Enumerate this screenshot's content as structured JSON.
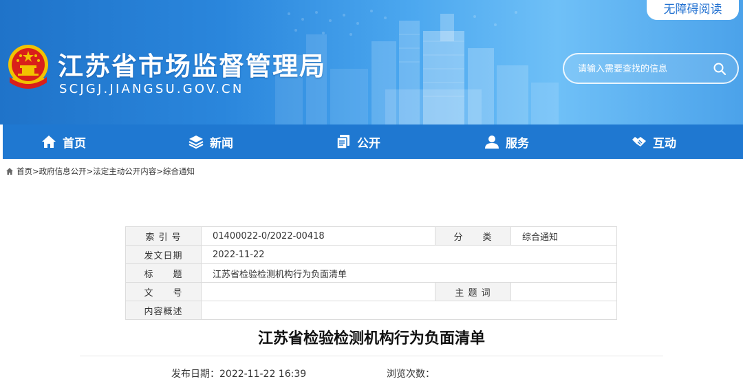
{
  "header": {
    "site_title": "江苏省市场监督管理局",
    "site_domain": "SCJGJ.JIANGSU.GOV.CN",
    "accessibility_label": "无障碍阅读",
    "search": {
      "placeholder": "请输入需要查找的信息",
      "value": ""
    }
  },
  "nav": {
    "items": [
      {
        "label": "首页",
        "icon": "home-icon"
      },
      {
        "label": "新闻",
        "icon": "layers-icon"
      },
      {
        "label": "公开",
        "icon": "documents-icon"
      },
      {
        "label": "服务",
        "icon": "user-icon"
      },
      {
        "label": "互动",
        "icon": "handshake-icon"
      }
    ]
  },
  "breadcrumb": {
    "items": [
      "首页",
      "政府信息公开",
      "法定主动公开内容",
      "综合通知"
    ],
    "separator": ">"
  },
  "info_table": {
    "index_label": "索 引 号",
    "index_value": "01400022-0/2022-00418",
    "category_label": "分　　类",
    "category_value": "综合通知",
    "date_label": "发文日期",
    "date_value": "2022-11-22",
    "title_label": "标　　题",
    "title_value": "江苏省检验检测机构行为负面清单",
    "doc_no_label": "文　　号",
    "doc_no_value": "",
    "keyword_label": "主 题 词",
    "keyword_value": "",
    "summary_label": "内容概述",
    "summary_value": ""
  },
  "article": {
    "title": "江苏省检验检测机构行为负面清单",
    "publish_label": "发布日期：",
    "publish_value": "2022-11-22 16:39",
    "views_label": "浏览次数："
  },
  "colors": {
    "nav_background": "#1f78d1",
    "header_gradient_start": "#1f73c9",
    "header_gradient_end": "#6fc0f7",
    "label_cell_background": "#f3f3f3"
  }
}
